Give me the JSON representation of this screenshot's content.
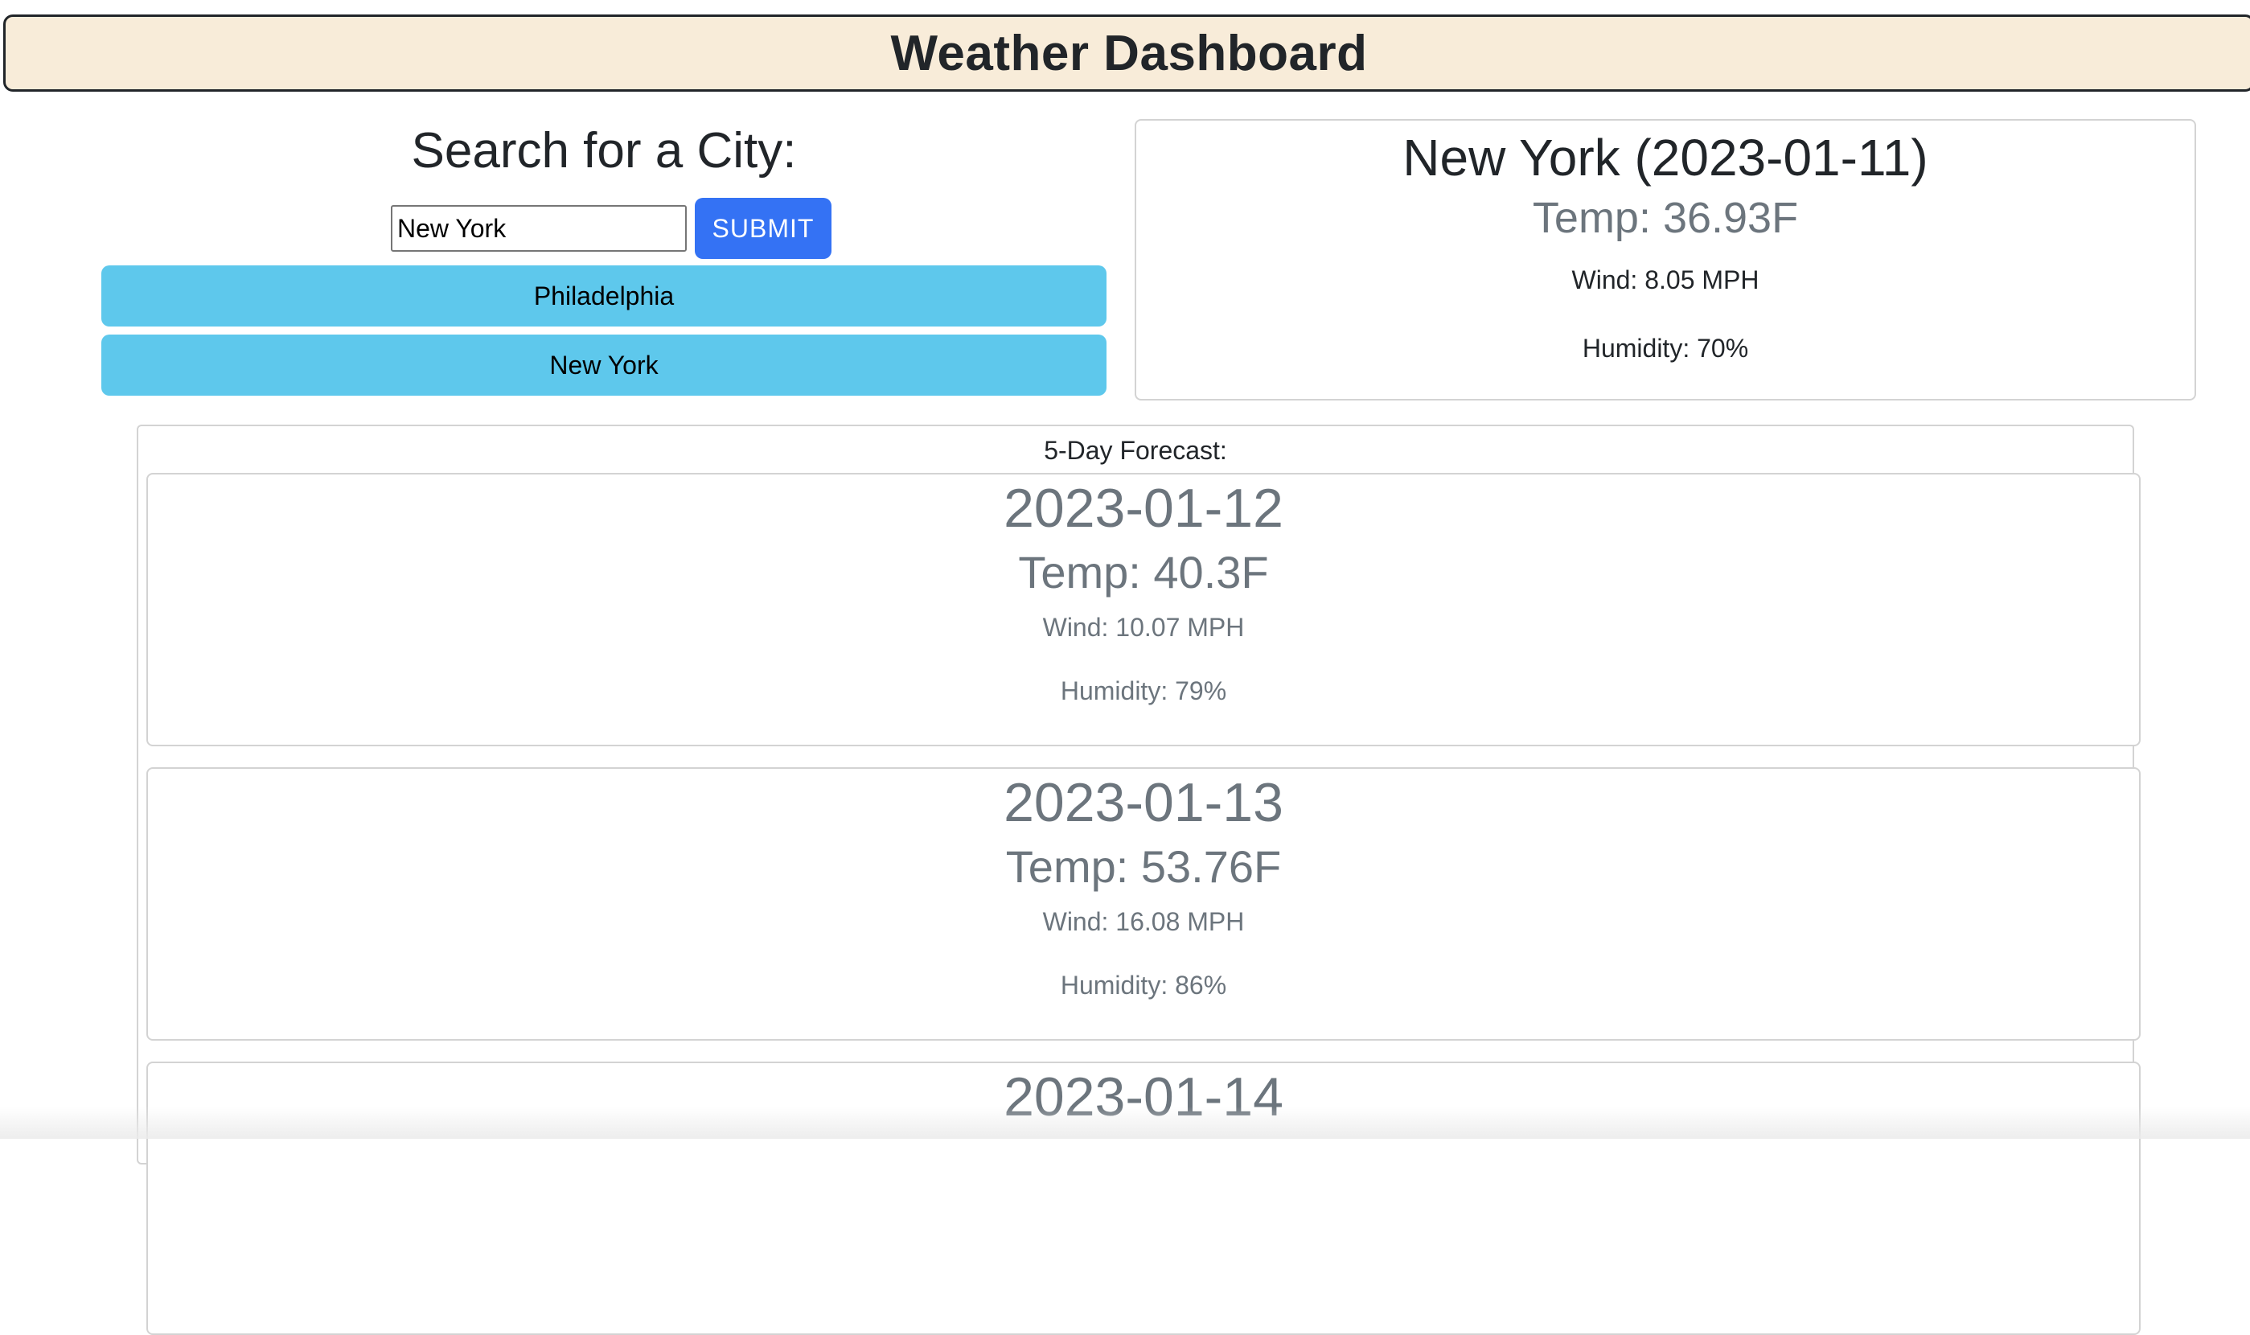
{
  "header": {
    "title": "Weather Dashboard"
  },
  "search": {
    "heading": "Search for a City:",
    "input_value": "New York",
    "submit_label": "SUBMIT",
    "history": [
      "Philadelphia",
      "New York"
    ]
  },
  "current": {
    "city_date": "New York (2023-01-11)",
    "temp": "Temp: 36.93F",
    "wind": "Wind: 8.05 MPH",
    "humidity": "Humidity: 70%"
  },
  "forecast": {
    "label": "5-Day Forecast:",
    "days": [
      {
        "date": "2023-01-12",
        "temp": "Temp: 40.3F",
        "wind": "Wind: 10.07 MPH",
        "humidity": "Humidity: 79%"
      },
      {
        "date": "2023-01-13",
        "temp": "Temp: 53.76F",
        "wind": "Wind: 16.08 MPH",
        "humidity": "Humidity: 86%"
      },
      {
        "date": "2023-01-14"
      }
    ]
  },
  "colors": {
    "header_bg": "#f8ecd9",
    "submit_bg": "#3472f4",
    "history_bg": "#5ec8ec",
    "muted_text": "#6c757d"
  }
}
